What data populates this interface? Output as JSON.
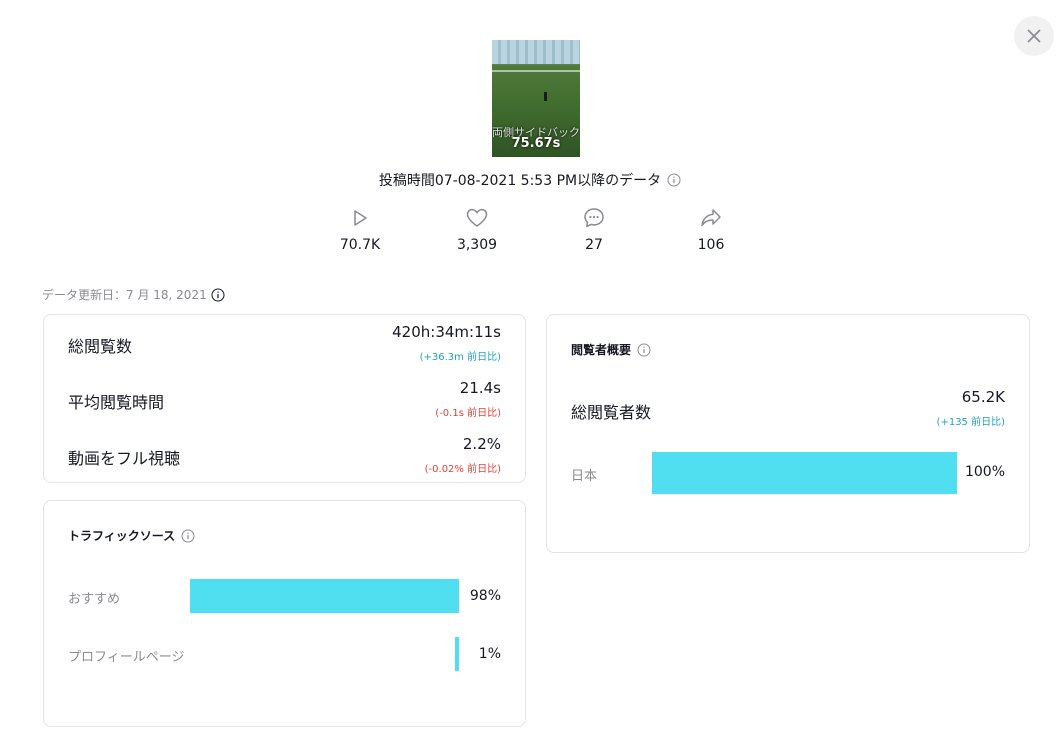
{
  "video": {
    "overlay_text": "両側サイドバックでチャンスメーカー",
    "duration": "75.67s"
  },
  "posted_text": "投稿時間07-08-2021 5:53 PM以降のデータ",
  "stats": [
    {
      "icon": "play-icon",
      "value": "70.7K"
    },
    {
      "icon": "heart-icon",
      "value": "3,309"
    },
    {
      "icon": "comment-icon",
      "value": "27"
    },
    {
      "icon": "share-icon",
      "value": "106"
    }
  ],
  "updated_text": "データ更新日：7 月 18, 2021",
  "metrics": [
    {
      "label": "総閲覧数",
      "value": "420h:34m:11s",
      "delta": "(+36.3m 前日比)",
      "trend": "up"
    },
    {
      "label": "平均閲覧時間",
      "value": "21.4s",
      "delta": "(-0.1s 前日比)",
      "trend": "down"
    },
    {
      "label": "動画をフル視聴",
      "value": "2.2%",
      "delta": "(-0.02% 前日比)",
      "trend": "down"
    }
  ],
  "traffic": {
    "title": "トラフィックソース",
    "items": [
      {
        "label": "おすすめ",
        "percent": 98,
        "display": "98%"
      },
      {
        "label": "プロフィールページ",
        "percent": 1,
        "display": "1%"
      }
    ]
  },
  "viewers": {
    "title": "閲覧者概要",
    "total_label": "総閲覧者数",
    "total_value": "65.2K",
    "total_delta": "(+135 前日比)",
    "regions": [
      {
        "label": "日本",
        "percent": 100,
        "display": "100%"
      }
    ]
  },
  "colors": {
    "bar": "#4fdff0",
    "delta_up": "#20a0c0",
    "delta_down": "#e0413a",
    "muted": "#8a8b91"
  }
}
